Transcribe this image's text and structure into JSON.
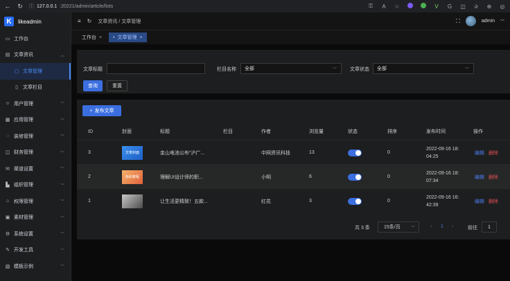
{
  "browser": {
    "url_host": "127.0.0.1",
    "url_path": ":20221/admin/article/lists"
  },
  "sidebar": {
    "brand": "likeadmin",
    "items": [
      {
        "label": "工作台",
        "icon": "monitor-icon"
      },
      {
        "label": "文章资讯",
        "icon": "news-icon",
        "expanded": true
      },
      {
        "label": "文章管理",
        "icon": "doc-icon",
        "active": true
      },
      {
        "label": "文章栏目",
        "icon": "column-icon"
      },
      {
        "label": "用户管理",
        "icon": "user-icon"
      },
      {
        "label": "应用管理",
        "icon": "app-icon"
      },
      {
        "label": "装修管理",
        "icon": "decor-icon"
      },
      {
        "label": "财务管理",
        "icon": "finance-icon"
      },
      {
        "label": "渠道设置",
        "icon": "channel-icon"
      },
      {
        "label": "组织管理",
        "icon": "org-icon"
      },
      {
        "label": "权限管理",
        "icon": "lock-icon"
      },
      {
        "label": "素材管理",
        "icon": "material-icon"
      },
      {
        "label": "系统设置",
        "icon": "settings-icon"
      },
      {
        "label": "开发工具",
        "icon": "tool-icon"
      },
      {
        "label": "模板示例",
        "icon": "template-icon"
      }
    ]
  },
  "header": {
    "breadcrumb": "文章资讯 / 文章管理",
    "user": "admin"
  },
  "tabs": [
    {
      "label": "工作台"
    },
    {
      "label": "文章管理"
    }
  ],
  "filter": {
    "title_label": "文章标题",
    "title_value": "",
    "column_label": "栏目名称",
    "column_value": "全部",
    "status_label": "文章状态",
    "status_value": "全部",
    "query_button": "查询",
    "reset_button": "重置"
  },
  "table": {
    "add_button": "发布文章",
    "headers": [
      "ID",
      "封面",
      "标题",
      "栏目",
      "作者",
      "浏览量",
      "状态",
      "排序",
      "发布时间",
      "操作"
    ],
    "rows": [
      {
        "id": "3",
        "cover_text": "文章封面",
        "title": "金山电池公布“沪广...",
        "column": "",
        "author": "中网资讯科技",
        "views": "13",
        "status": true,
        "sort": "0",
        "time_date": "2022-09-16 18:",
        "time_clock": "04:25",
        "edit": "编辑",
        "delete": "删除"
      },
      {
        "id": "2",
        "cover_text": "色彩教程",
        "title": "理解UI设计师的职...",
        "column": "",
        "author": "小明",
        "views": "6",
        "status": true,
        "sort": "0",
        "time_date": "2022-09-16 18:",
        "time_clock": "07:34",
        "edit": "编辑",
        "delete": "删除"
      },
      {
        "id": "1",
        "cover_text": "",
        "title": "让生活更精致！五款...",
        "column": "",
        "author": "红花",
        "views": "3",
        "status": true,
        "sort": "0",
        "time_date": "2022-09-16 16:",
        "time_clock": "42:39",
        "edit": "编辑",
        "delete": "删除"
      }
    ]
  },
  "pager": {
    "total": "共 3 条",
    "page_size": "15条/页",
    "current_page": "1",
    "goto_label": "前往",
    "goto_value": "1"
  }
}
